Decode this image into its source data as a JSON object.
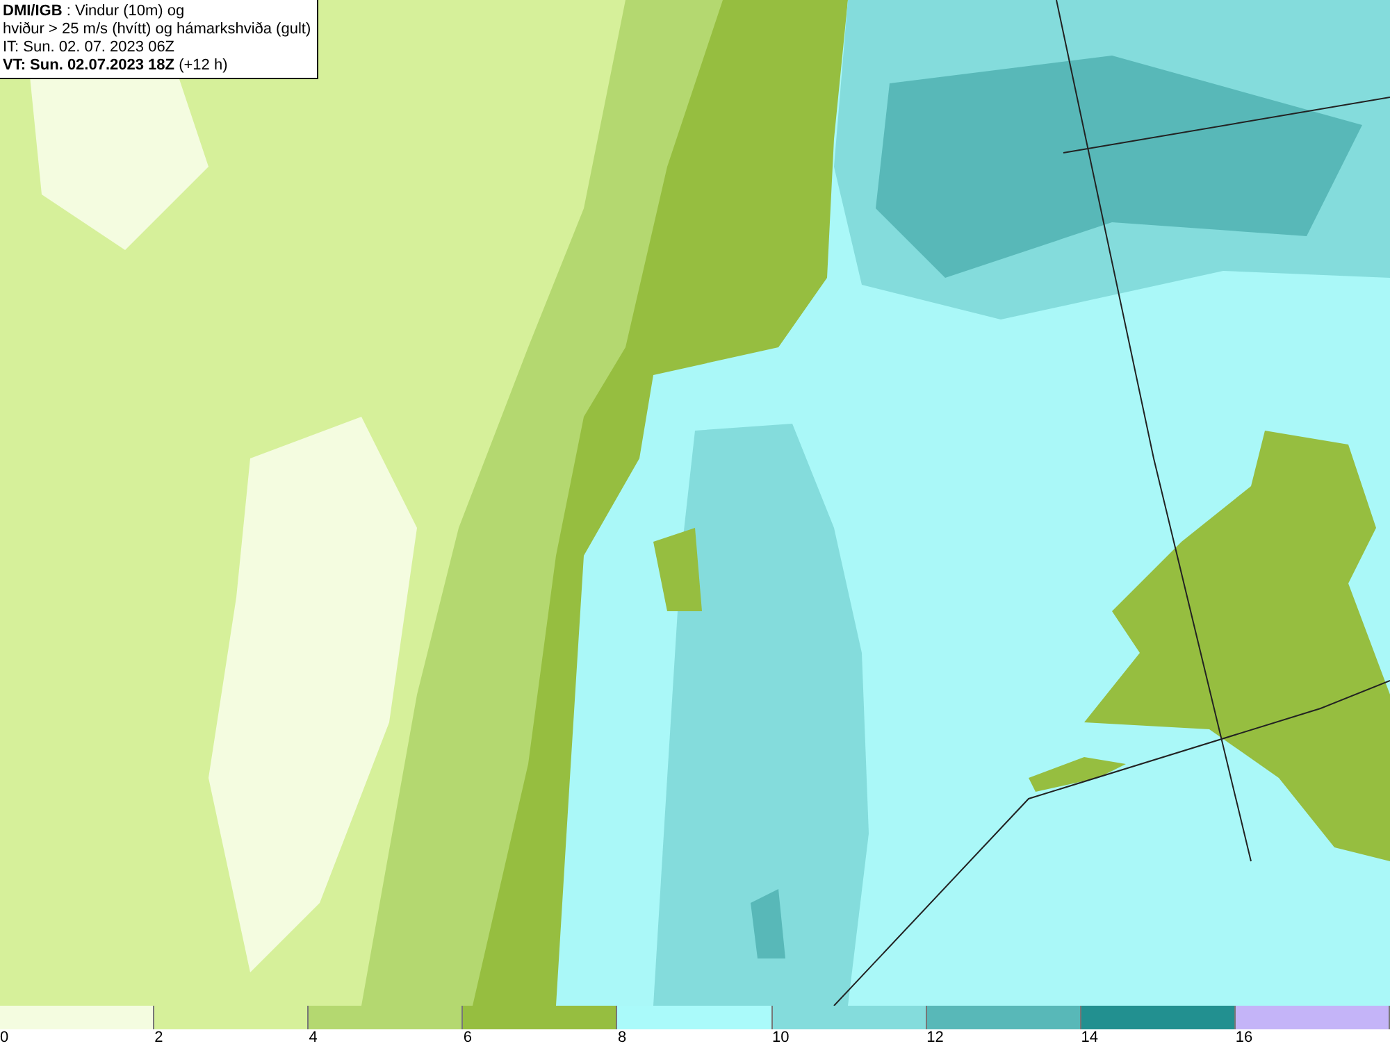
{
  "header": {
    "lines": [
      "**DMI/IGB** : Vindur (10m) og",
      "hviður > 25 m/s (hvítt) og hámarkshviða (gult)",
      "IT: Sun. 02. 07. 2023 06Z",
      "**VT: Sun. 02.07.2023 18Z** (+12 h)"
    ]
  },
  "legend": {
    "bins": [
      {
        "color": "#f4fce0"
      },
      {
        "color": "#d6f09a"
      },
      {
        "color": "#b4d870"
      },
      {
        "color": "#96be40"
      },
      {
        "color": "#aafafa"
      },
      {
        "color": "#84dcdc"
      },
      {
        "color": "#58b8b8"
      },
      {
        "color": "#229090"
      },
      {
        "color": "#c4b4f8"
      }
    ],
    "ticks": [
      "0",
      "2",
      "4",
      "6",
      "8",
      "10",
      "12",
      "14",
      "16"
    ]
  }
}
